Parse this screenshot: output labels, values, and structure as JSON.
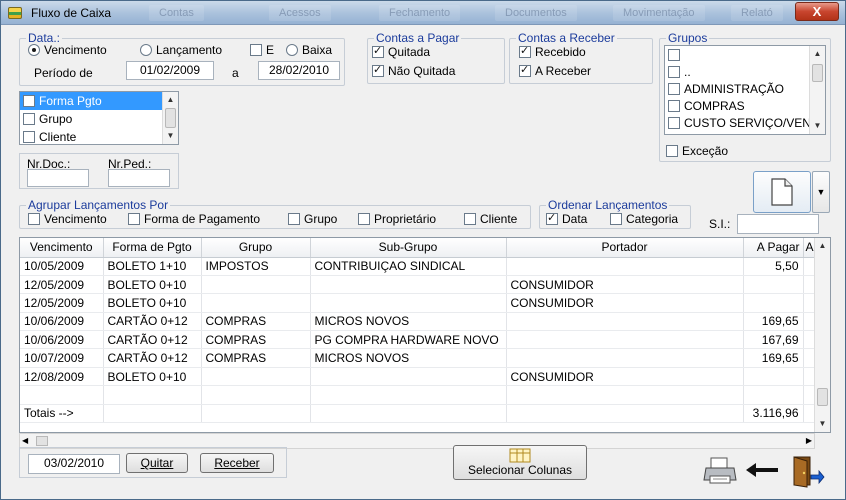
{
  "window": {
    "title": "Fluxo de Caixa",
    "close_label": "X",
    "background_tabs": [
      "Contas",
      "Acessos",
      "Fechamento",
      "Documentos",
      "Movimentação",
      "Relató"
    ]
  },
  "data_group": {
    "legend": "Data.:",
    "options": [
      "Vencimento",
      "Lançamento",
      "E",
      "Baixa"
    ],
    "periodo_label": "Período de",
    "date_from": "01/02/2009",
    "connector": "a",
    "date_to": "28/02/2010"
  },
  "contas_pagar": {
    "legend": "Contas a Pagar",
    "options": [
      "Quitada",
      "Não Quitada"
    ]
  },
  "contas_receber": {
    "legend": "Contas a Receber",
    "options": [
      "Recebido",
      "A Receber"
    ]
  },
  "grupos": {
    "legend": "Grupos",
    "items": [
      "",
      "..",
      "ADMINISTRAÇÃO",
      "COMPRAS",
      "CUSTO SERVIÇO/VEN"
    ],
    "excecao_label": "Exceção"
  },
  "filter_list": {
    "items": [
      "Forma Pgto",
      "Grupo",
      "Cliente"
    ]
  },
  "doc_fields": {
    "nr_doc_label": "Nr.Doc.:",
    "nr_ped_label": "Nr.Ped.:"
  },
  "agrupar": {
    "legend": "Agrupar Lançamentos Por",
    "options": [
      "Vencimento",
      "Forma de Pagamento",
      "Grupo",
      "Proprietário",
      "Cliente"
    ]
  },
  "ordenar": {
    "legend": "Ordenar Lançamentos",
    "options": [
      "Data",
      "Categoria"
    ]
  },
  "si_label": "S.I.:",
  "grid": {
    "columns": [
      "Vencimento",
      "Forma de Pgto",
      "Grupo",
      "Sub-Grupo",
      "Portador",
      "A Pagar",
      "A"
    ],
    "rows": [
      [
        "10/05/2009",
        "BOLETO 1+10",
        "IMPOSTOS",
        "CONTRIBUIÇAO SINDICAL",
        "",
        "5,50"
      ],
      [
        "12/05/2009",
        "BOLETO 0+10",
        "",
        "",
        "CONSUMIDOR",
        ""
      ],
      [
        "12/05/2009",
        "BOLETO 0+10",
        "",
        "",
        "CONSUMIDOR",
        ""
      ],
      [
        "10/06/2009",
        "CARTÃO 0+12",
        "COMPRAS",
        "MICROS NOVOS",
        "",
        "169,65"
      ],
      [
        "10/06/2009",
        "CARTÃO 0+12",
        "COMPRAS",
        "PG COMPRA HARDWARE NOVO",
        "",
        "167,69"
      ],
      [
        "10/07/2009",
        "CARTÃO 0+12",
        "COMPRAS",
        "MICROS NOVOS",
        "",
        "169,65"
      ],
      [
        "12/08/2009",
        "BOLETO 0+10",
        "",
        "",
        "CONSUMIDOR",
        ""
      ],
      [
        "",
        "",
        "",
        "",
        "",
        ""
      ],
      [
        "Totais -->",
        "",
        "",
        "",
        "",
        "3.116,96"
      ]
    ]
  },
  "footer": {
    "date": "03/02/2010",
    "quitar_label": "Quitar",
    "receber_label": "Receber",
    "selecionar_colunas_label": "Selecionar Colunas"
  }
}
